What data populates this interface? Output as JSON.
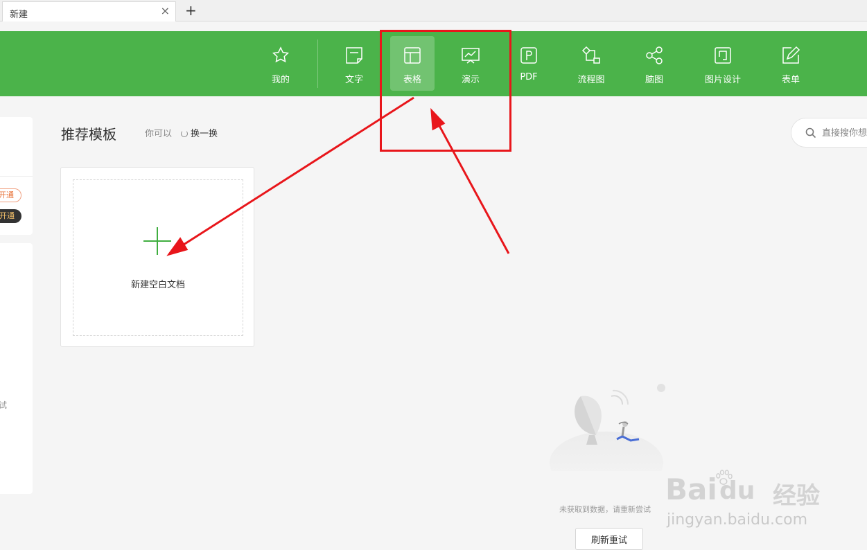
{
  "tabbar": {
    "tab_title": "新建",
    "close_glyph": "×",
    "add_glyph": "+"
  },
  "toolbar": {
    "items": [
      {
        "label": "我的",
        "icon": "star-icon"
      },
      {
        "label": "文字",
        "icon": "document-icon"
      },
      {
        "label": "表格",
        "icon": "table-icon",
        "active": true
      },
      {
        "label": "演示",
        "icon": "presentation-icon"
      },
      {
        "label": "PDF",
        "icon": "pdf-icon"
      },
      {
        "label": "流程图",
        "icon": "flowchart-icon"
      },
      {
        "label": "脑图",
        "icon": "mindmap-icon"
      },
      {
        "label": "图片设计",
        "icon": "image-design-icon"
      },
      {
        "label": "表单",
        "icon": "form-icon"
      }
    ],
    "color": "#4bb34a"
  },
  "sidebar": {
    "pill_open_1": "开通",
    "pill_open_2": "开通",
    "retry_fragment": "试"
  },
  "main": {
    "section_title": "推荐模板",
    "hint": "你可以",
    "shuffle_label": "换一换",
    "search_placeholder": "直接搜你想",
    "new_blank_label": "新建空白文档",
    "empty_text": "未获取到数据，请重新尝试",
    "retry_label": "刷新重试"
  },
  "watermark": {
    "brand": "Bai",
    "brand_suffix": "du",
    "jingyan": "经验",
    "url": "jingyan.baidu.com"
  },
  "annotation": {
    "color": "#e8161b"
  }
}
